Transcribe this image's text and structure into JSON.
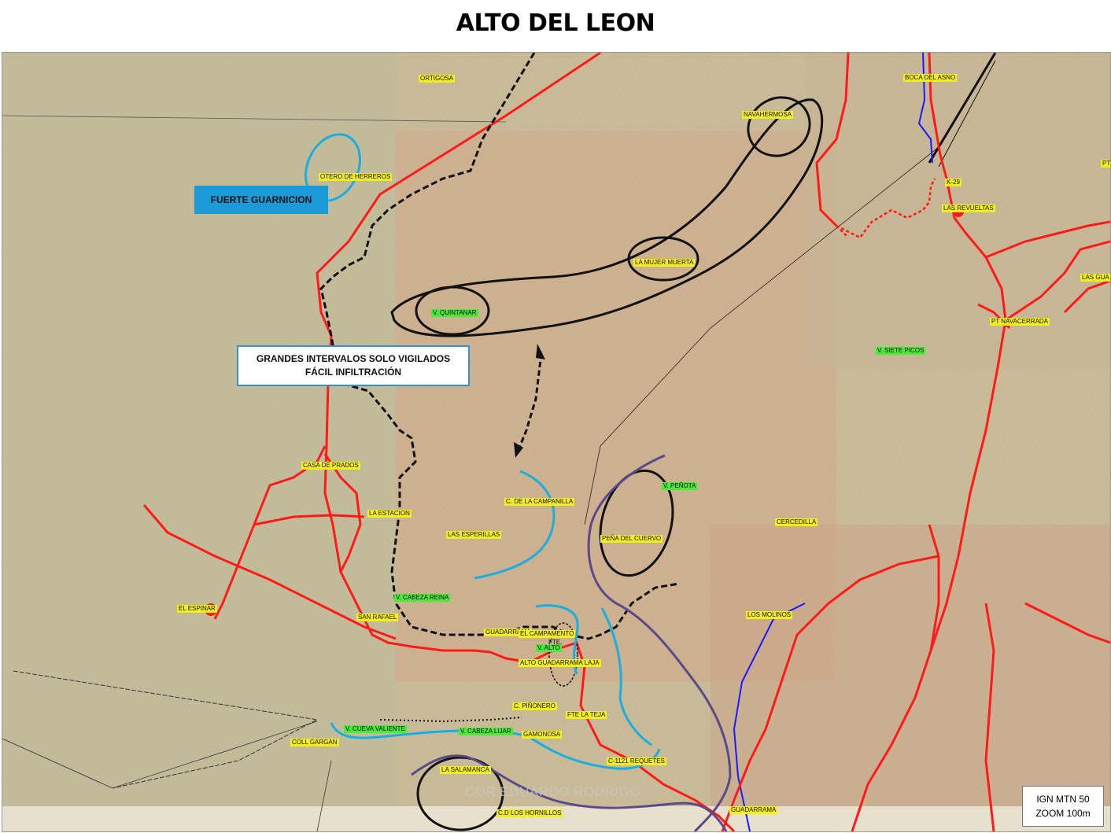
{
  "title": "ALTO DEL LEON",
  "boxes": {
    "fuerte": "FUERTE GUARNICION",
    "intervalos_line1": "GRANDES INTERVALOS SOLO VIGILADOS",
    "intervalos_line2": "FÁCIL INFILTRACIÓN",
    "source_line1": "IGN MTN 50",
    "source_line2": "ZOOM 100m"
  },
  "watermark": "COR EDUARDO RODRIGO",
  "colors": {
    "roads": "#ff1a1a",
    "front_line": "#111111",
    "rivers": "#1a1aff",
    "blue_arcs": "#1aaee0",
    "purple_arcs": "#5a4a8a",
    "label_yellow": "#f3ee1e",
    "label_green": "#4ce83a",
    "box_blue": "#1b9ad8"
  },
  "labels": {
    "ortigosa": "ORTIGOSA",
    "boca_del_asno": "BOCA DEL ASNO",
    "navahermosa": "NAVAHERMOSA",
    "otero": "OTERO DE HERREROS",
    "k29": "K-29",
    "las_revueltas": "LAS REVUELTAS",
    "pt": "PT",
    "las_gua": "LAS GUA",
    "mujer_muerta": "LA MUJER MUERTA",
    "quintanar": "V. QUINTANAR",
    "navacerrada_pt": "PT NAVACERRADA",
    "siete_picos": "V. SIETE PICOS",
    "casa_prados": "CASA DE PRADOS",
    "la_estacion": "LA ESTACION",
    "penota": "V. PEÑOTA",
    "campanilla": "C. DE LA CAMPANILLA",
    "esperillas": "LAS ESPERILLAS",
    "pena_cuervo": "PEÑA DEL CUERVO",
    "cercedilla": "CERCEDILLA",
    "cabeza_reina": "V. CABEZA REINA",
    "el_espinar": "EL ESPINAR",
    "san_rafael": "SAN RAFAEL",
    "los_molinos": "LOS MOLINOS",
    "guadarrama_v": "GUADARRAMA",
    "el_campamento": "EL CAMPAMENTO",
    "fte": "FTE.",
    "v_alto": "V. ALTO",
    "alto_guadarrama": "ALTO GUADARRAMA LAJA",
    "pinonero": "C. PIÑONERO",
    "fte_teja": "FTE LA TEJA",
    "cueva_valiente": "V. CUEVA VALIENTE",
    "cabeza_lijar": "V. CABEZA LIJAR",
    "gamonosa": "GAMONOSA",
    "coll_gargan": "COLL GARGAN",
    "salamanca": "LA SALAMANCA",
    "requetes": "C-1121 REQUETES",
    "hornillos": "C.D LOS HORNILLOS",
    "guadarrama": "GUADARRAMA"
  }
}
